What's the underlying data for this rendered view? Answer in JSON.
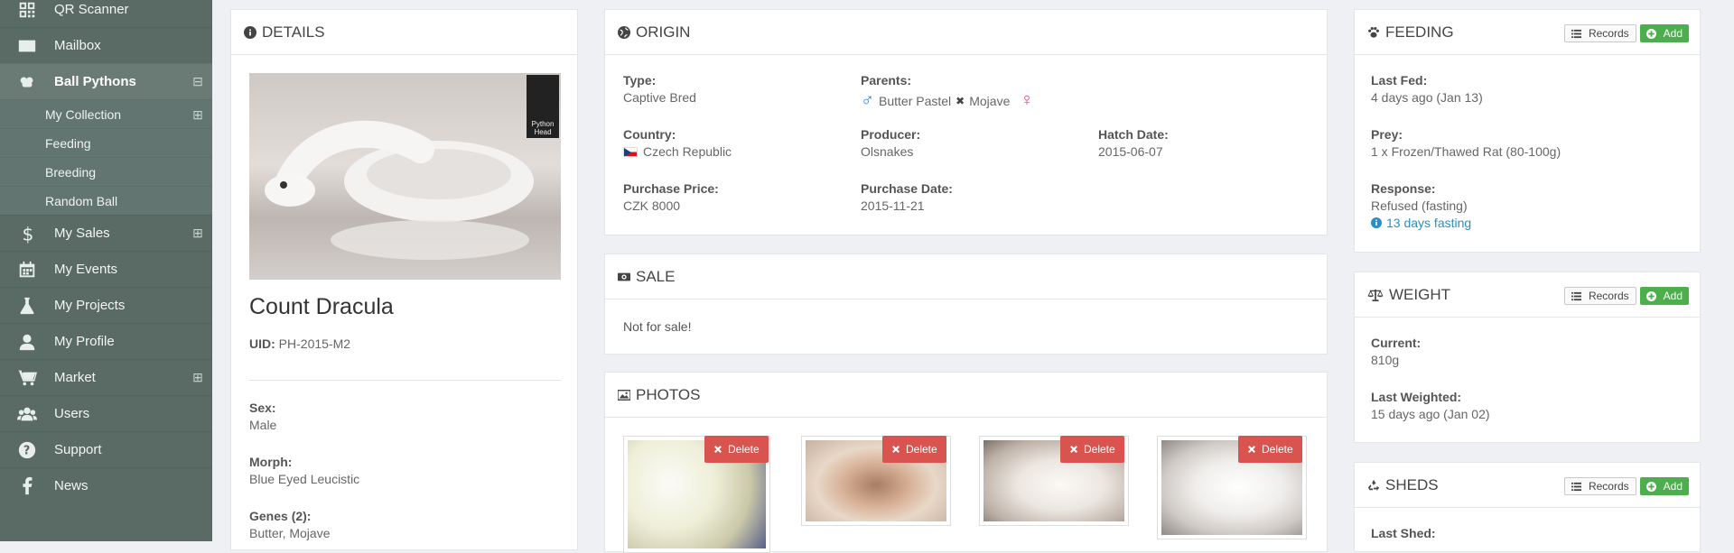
{
  "sidebar": {
    "items": [
      {
        "label": "QR Scanner",
        "icon": "qr-code-icon"
      },
      {
        "label": "Mailbox",
        "icon": "envelope-icon"
      },
      {
        "label": "Ball Pythons",
        "icon": "python-icon",
        "expanded_symbol": "⊟"
      },
      {
        "label": "My Sales",
        "icon": "dollar-icon",
        "expand_symbol": "⊞"
      },
      {
        "label": "My Events",
        "icon": "calendar-icon"
      },
      {
        "label": "My Projects",
        "icon": "flask-icon"
      },
      {
        "label": "My Profile",
        "icon": "user-icon"
      },
      {
        "label": "Market",
        "icon": "cart-icon",
        "expand_symbol": "⊞"
      },
      {
        "label": "Users",
        "icon": "users-icon"
      },
      {
        "label": "Support",
        "icon": "question-icon"
      },
      {
        "label": "News",
        "icon": "facebook-icon"
      }
    ],
    "subitems": [
      {
        "label": "My Collection",
        "expand_symbol": "⊞"
      },
      {
        "label": "Feeding"
      },
      {
        "label": "Breeding"
      },
      {
        "label": "Random Ball"
      }
    ]
  },
  "details": {
    "title": "DETAILS",
    "watermark": "Python Head",
    "name": "Count Dracula",
    "uid_label": "UID:",
    "uid": "PH-2015-M2",
    "sex_label": "Sex:",
    "sex": "Male",
    "morph_label": "Morph:",
    "morph": "Blue Eyed Leucistic",
    "genes_label": "Genes (2):",
    "genes": "Butter, Mojave"
  },
  "origin": {
    "title": "ORIGIN",
    "type_label": "Type:",
    "type": "Captive Bred",
    "parents_label": "Parents:",
    "father": "Butter Pastel",
    "cross": "✖",
    "mother": "Mojave",
    "country_label": "Country:",
    "country": "Czech Republic",
    "producer_label": "Producer:",
    "producer": "Olsnakes",
    "hatch_label": "Hatch Date:",
    "hatch": "2015-06-07",
    "price_label": "Purchase Price:",
    "price": "CZK 8000",
    "pdate_label": "Purchase Date:",
    "pdate": "2015-11-21"
  },
  "sale": {
    "title": "SALE",
    "text": "Not for sale!"
  },
  "photos": {
    "title": "PHOTOS",
    "delete_label": "Delete"
  },
  "feeding": {
    "title": "FEEDING",
    "records_label": "Records",
    "add_label": "Add",
    "last_fed_label": "Last Fed:",
    "last_fed": "4 days ago (Jan 13)",
    "prey_label": "Prey:",
    "prey": "1 x Frozen/Thawed Rat (80-100g)",
    "response_label": "Response:",
    "response": "Refused (fasting)",
    "fasting_link": "13 days fasting"
  },
  "weight": {
    "title": "WEIGHT",
    "records_label": "Records",
    "add_label": "Add",
    "current_label": "Current:",
    "current": "810g",
    "last_label": "Last Weighted:",
    "last": "15 days ago (Jan 02)"
  },
  "sheds": {
    "title": "SHEDS",
    "records_label": "Records",
    "add_label": "Add",
    "last_label": "Last Shed:"
  },
  "colors": {
    "sidebar": "#5a6b65",
    "add_green": "#4cae4c",
    "delete_red": "#d9534f",
    "link_blue": "#2a8fc7",
    "male_blue": "#2b7fd6",
    "female_pink": "#e0408a"
  }
}
